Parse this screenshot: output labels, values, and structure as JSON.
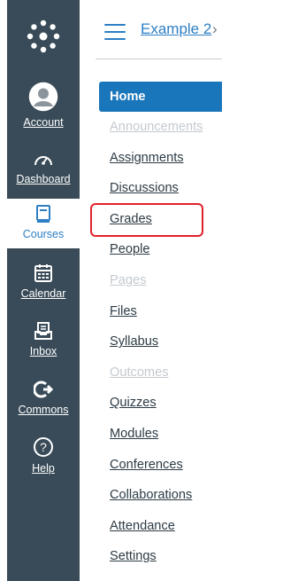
{
  "global_nav": {
    "items": [
      {
        "key": "account",
        "label": "Account",
        "icon": "avatar-icon",
        "active": false
      },
      {
        "key": "dashboard",
        "label": "Dashboard",
        "icon": "dashboard-gauge-icon",
        "active": false
      },
      {
        "key": "courses",
        "label": "Courses",
        "icon": "book-icon",
        "active": true
      },
      {
        "key": "calendar",
        "label": "Calendar",
        "icon": "calendar-icon",
        "active": false
      },
      {
        "key": "inbox",
        "label": "Inbox",
        "icon": "inbox-icon",
        "active": false
      },
      {
        "key": "commons",
        "label": "Commons",
        "icon": "commons-arrow-icon",
        "active": false
      },
      {
        "key": "help",
        "label": "Help",
        "icon": "help-icon",
        "active": false
      }
    ]
  },
  "header": {
    "breadcrumb": "Example 2",
    "separator": "›"
  },
  "course_menu": {
    "items": [
      {
        "label": "Home",
        "state": "active"
      },
      {
        "label": "Announcements",
        "state": "disabled"
      },
      {
        "label": "Assignments",
        "state": "normal"
      },
      {
        "label": "Discussions",
        "state": "normal"
      },
      {
        "label": "Grades",
        "state": "highlighted"
      },
      {
        "label": "People",
        "state": "normal"
      },
      {
        "label": "Pages",
        "state": "disabled"
      },
      {
        "label": "Files",
        "state": "normal"
      },
      {
        "label": "Syllabus",
        "state": "normal"
      },
      {
        "label": "Outcomes",
        "state": "disabled"
      },
      {
        "label": "Quizzes",
        "state": "normal"
      },
      {
        "label": "Modules",
        "state": "normal"
      },
      {
        "label": "Conferences",
        "state": "normal"
      },
      {
        "label": "Collaborations",
        "state": "normal"
      },
      {
        "label": "Attendance",
        "state": "normal"
      },
      {
        "label": "Settings",
        "state": "normal"
      }
    ]
  },
  "colors": {
    "nav_bg": "#394b58",
    "accent": "#2d7fc4",
    "active_item": "#1a76ba",
    "highlight_border": "#e0212a"
  }
}
